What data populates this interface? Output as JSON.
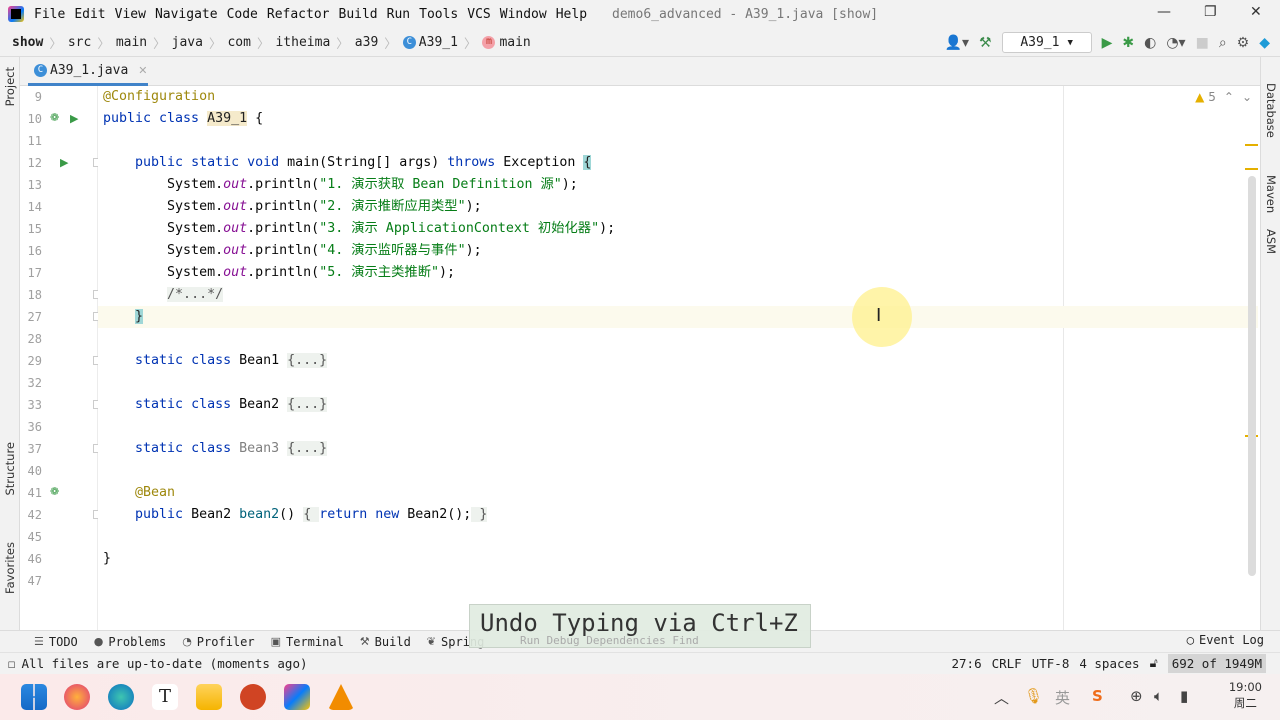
{
  "menubar": {
    "items": [
      "File",
      "Edit",
      "View",
      "Navigate",
      "Code",
      "Refactor",
      "Build",
      "Run",
      "Tools",
      "VCS",
      "Window",
      "Help"
    ],
    "title": "demo6_advanced - A39_1.java [show]"
  },
  "breadcrumb": [
    "show",
    "src",
    "main",
    "java",
    "com",
    "itheima",
    "a39",
    "A39_1",
    "main"
  ],
  "toolbar": {
    "run_config": "A39_1"
  },
  "tab": {
    "label": "A39_1.java"
  },
  "left_strip": {
    "project": "Project",
    "structure": "Structure",
    "favorites": "Favorites"
  },
  "right_strip": {
    "database": "Database",
    "maven": "Maven",
    "asm": "ASM"
  },
  "inspections": {
    "warnings": "5"
  },
  "code": [
    {
      "n": "9",
      "t": [
        [
          "ann",
          "@Configuration"
        ]
      ]
    },
    {
      "n": "10",
      "t": [
        [
          "kw",
          "public class "
        ],
        [
          "hl",
          "A39_1"
        ],
        [
          "plain",
          " {"
        ]
      ]
    },
    {
      "n": "11",
      "t": []
    },
    {
      "n": "12",
      "t": [
        [
          "plain",
          "    "
        ],
        [
          "kw",
          "public static void "
        ],
        [
          "plain",
          "main(String[] args) "
        ],
        [
          "kw",
          "throws "
        ],
        [
          "plain",
          "Exception "
        ],
        [
          "brace",
          "{"
        ]
      ]
    },
    {
      "n": "13",
      "t": [
        [
          "plain",
          "        System."
        ],
        [
          "fld",
          "out"
        ],
        [
          "plain",
          ".println("
        ],
        [
          "str",
          "\"1. 演示获取 Bean Definition 源\""
        ],
        [
          "plain",
          ");"
        ]
      ]
    },
    {
      "n": "14",
      "t": [
        [
          "plain",
          "        System."
        ],
        [
          "fld",
          "out"
        ],
        [
          "plain",
          ".println("
        ],
        [
          "str",
          "\"2. 演示推断应用类型\""
        ],
        [
          "plain",
          ");"
        ]
      ]
    },
    {
      "n": "15",
      "t": [
        [
          "plain",
          "        System."
        ],
        [
          "fld",
          "out"
        ],
        [
          "plain",
          ".println("
        ],
        [
          "str",
          "\"3. 演示 ApplicationContext 初始化器\""
        ],
        [
          "plain",
          ");"
        ]
      ]
    },
    {
      "n": "16",
      "t": [
        [
          "plain",
          "        System."
        ],
        [
          "fld",
          "out"
        ],
        [
          "plain",
          ".println("
        ],
        [
          "str",
          "\"4. 演示监听器与事件\""
        ],
        [
          "plain",
          ");"
        ]
      ]
    },
    {
      "n": "17",
      "t": [
        [
          "plain",
          "        System."
        ],
        [
          "fld",
          "out"
        ],
        [
          "plain",
          ".println("
        ],
        [
          "str",
          "\"5. 演示主类推断\""
        ],
        [
          "plain",
          ");"
        ]
      ]
    },
    {
      "n": "18",
      "t": [
        [
          "plain",
          "        "
        ],
        [
          "fold",
          "/*...*/"
        ]
      ]
    },
    {
      "n": "27",
      "t": [
        [
          "plain",
          "    "
        ],
        [
          "brace",
          "}"
        ]
      ],
      "current": true
    },
    {
      "n": "28",
      "t": []
    },
    {
      "n": "29",
      "t": [
        [
          "plain",
          "    "
        ],
        [
          "kw",
          "static class "
        ],
        [
          "plain",
          "Bean1 "
        ],
        [
          "fold",
          "{...}"
        ]
      ]
    },
    {
      "n": "32",
      "t": []
    },
    {
      "n": "33",
      "t": [
        [
          "plain",
          "    "
        ],
        [
          "kw",
          "static class "
        ],
        [
          "plain",
          "Bean2 "
        ],
        [
          "fold",
          "{...}"
        ]
      ]
    },
    {
      "n": "36",
      "t": []
    },
    {
      "n": "37",
      "t": [
        [
          "plain",
          "    "
        ],
        [
          "kw",
          "static class "
        ],
        [
          "dim",
          "Bean3 "
        ],
        [
          "fold",
          "{...}"
        ]
      ]
    },
    {
      "n": "40",
      "t": []
    },
    {
      "n": "41",
      "t": [
        [
          "plain",
          "    "
        ],
        [
          "ann",
          "@Bean"
        ]
      ]
    },
    {
      "n": "42",
      "t": [
        [
          "plain",
          "    "
        ],
        [
          "kw",
          "public "
        ],
        [
          "plain",
          "Bean2 "
        ],
        [
          "kw2",
          "bean2"
        ],
        [
          "plain",
          "() "
        ],
        [
          "fold",
          "{ "
        ],
        [
          "kw",
          "return new "
        ],
        [
          "plain",
          "Bean2();"
        ],
        [
          "fold",
          " }"
        ]
      ]
    },
    {
      "n": "45",
      "t": []
    },
    {
      "n": "46",
      "t": [
        [
          "plain",
          "}"
        ]
      ]
    },
    {
      "n": "47",
      "t": []
    }
  ],
  "toolwindows": [
    "TODO",
    "Problems",
    "Profiler",
    "Terminal",
    "Build",
    "Spring"
  ],
  "event_log": "Event Log",
  "undo_popup": {
    "text": "Undo Typing via Ctrl+Z",
    "ghost": "Run   Debug   Dependencies   Find"
  },
  "status": {
    "message": "All files are up-to-date (moments ago)",
    "position": "27:6",
    "line_separator": "CRLF",
    "encoding": "UTF-8",
    "indent": "4 spaces",
    "memory": "692 of 1949M"
  },
  "clock": {
    "time": "19:00",
    "day": "周二"
  },
  "colors": {
    "keyword": "#0033b3",
    "string": "#067d17",
    "annotation": "#9e880d",
    "field": "#871094",
    "accent": "#4083c9"
  }
}
